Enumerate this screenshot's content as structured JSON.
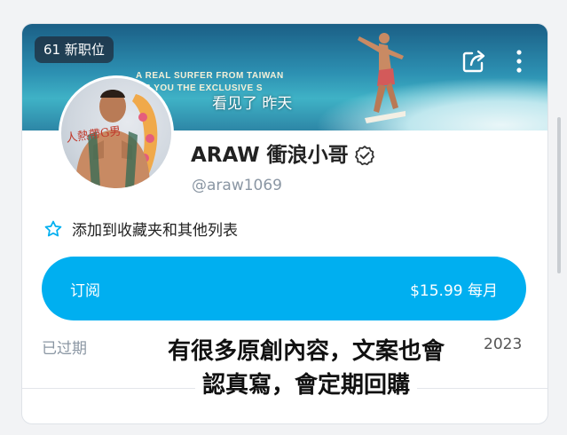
{
  "banner": {
    "badge": "61 新职位",
    "image_text_line1": "A REAL SURFER FROM TAIWAN",
    "image_text_line2": "WS YOU THE          EXCLUSIVE S",
    "seen_status": "看见了 昨天",
    "share_icon": "share-icon",
    "more_icon": "more-vertical-icon"
  },
  "profile": {
    "name": "ARAW 衝浪小哥",
    "handle": "@araw1069",
    "avatar_text": "人熱帶G男"
  },
  "favorites": {
    "label": "添加到收藏夹和其他列表",
    "icon": "star-outline-icon"
  },
  "subscribe": {
    "label": "订阅",
    "price": "$15.99 每月",
    "color": "#00aff0"
  },
  "status": {
    "expired_label": "已过期",
    "year": "2023"
  },
  "caption": {
    "line1": "有很多原創內容，文案也會",
    "line2": "認真寫，會定期回購"
  }
}
